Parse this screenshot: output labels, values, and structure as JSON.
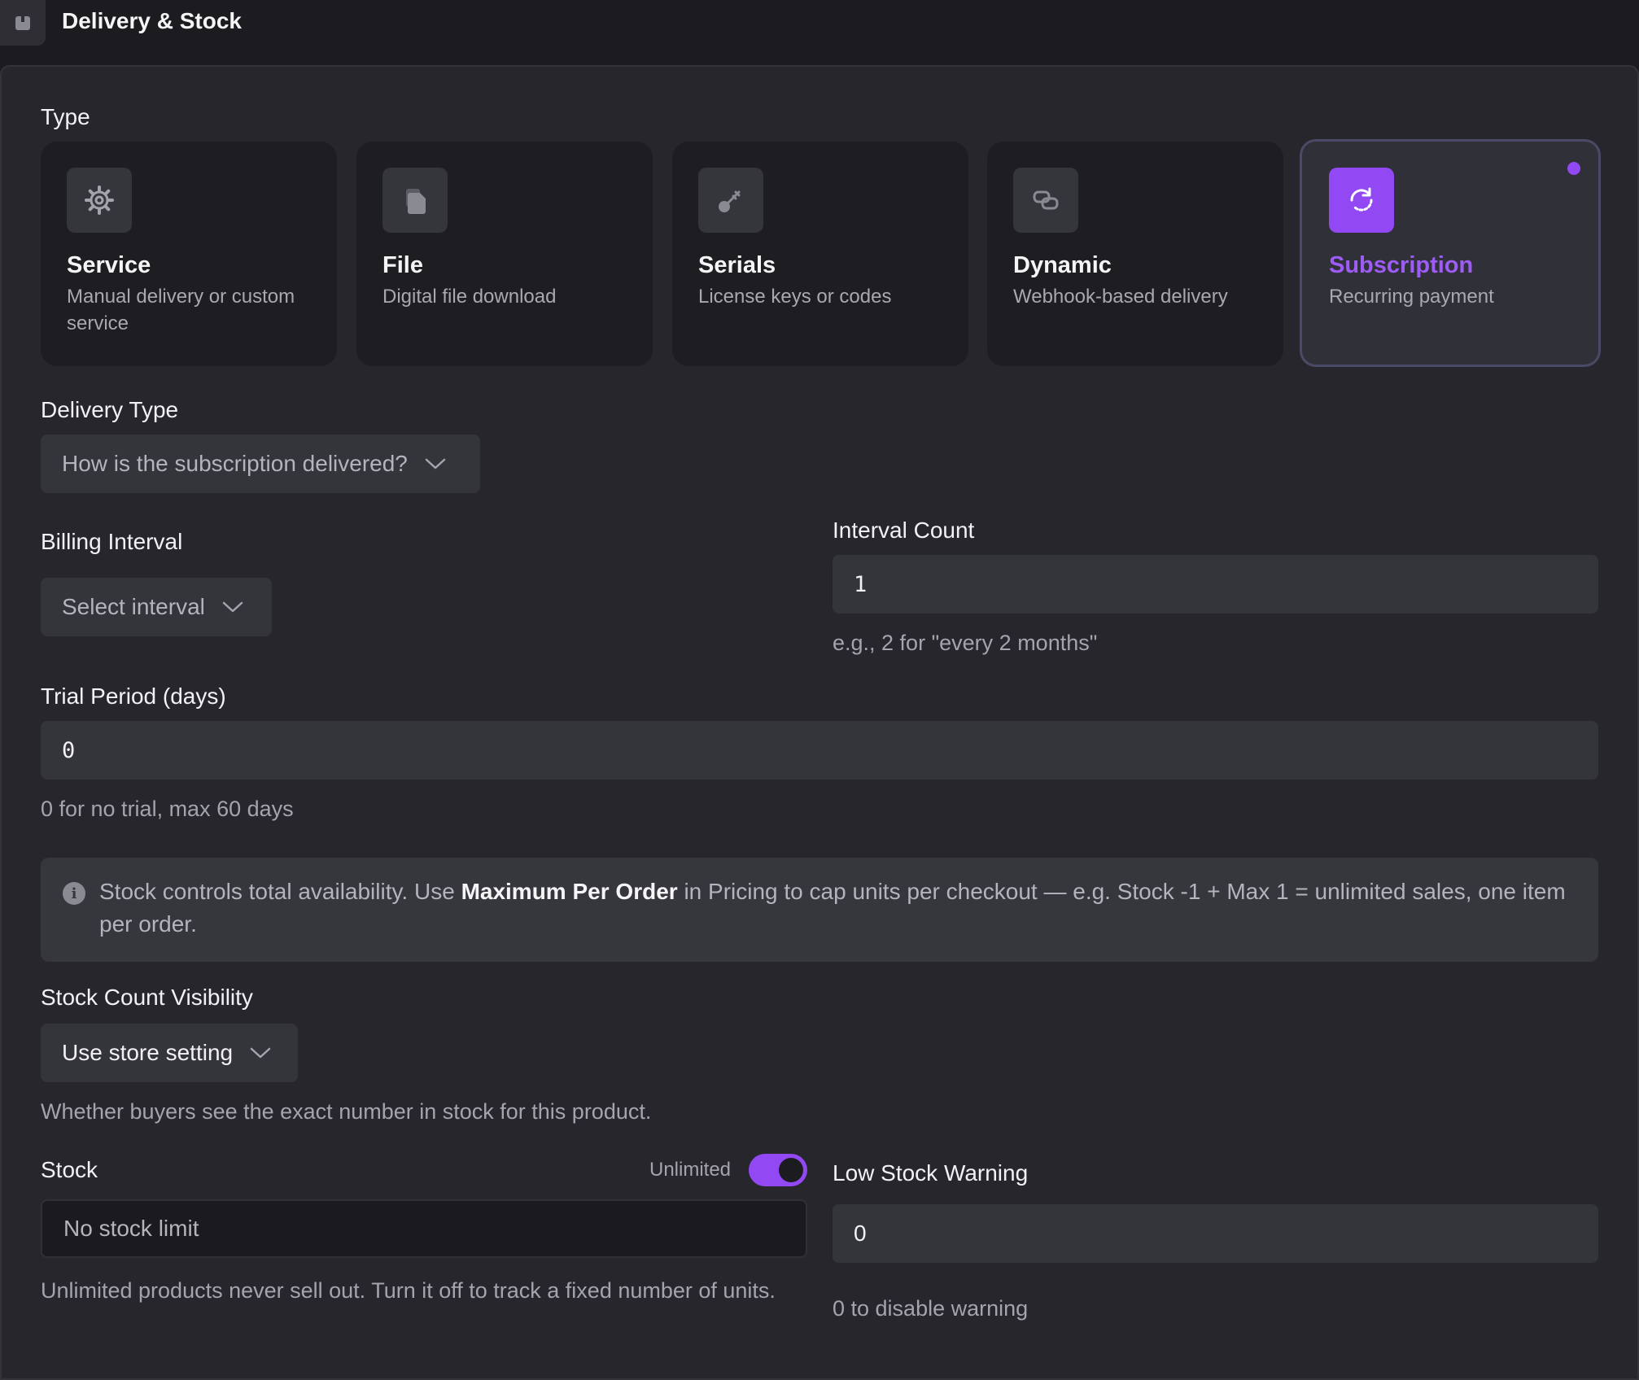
{
  "header": {
    "title": "Delivery & Stock",
    "icon": "box-icon"
  },
  "type_section": {
    "label": "Type",
    "cards": [
      {
        "name": "Service",
        "desc": "Manual delivery or custom service",
        "icon": "gear-icon"
      },
      {
        "name": "File",
        "desc": "Digital file download",
        "icon": "file-icon"
      },
      {
        "name": "Serials",
        "desc": "License keys or codes",
        "icon": "key-icon"
      },
      {
        "name": "Dynamic",
        "desc": "Webhook-based delivery",
        "icon": "link-icon"
      },
      {
        "name": "Subscription",
        "desc": "Recurring payment",
        "icon": "refresh-icon"
      }
    ],
    "selected": "Subscription"
  },
  "delivery_type": {
    "label": "Delivery Type",
    "placeholder": "How is the subscription delivered?"
  },
  "billing_interval": {
    "label": "Billing Interval",
    "placeholder": "Select interval"
  },
  "interval_count": {
    "label": "Interval Count",
    "value": "1",
    "hint": "e.g., 2 for \"every 2 months\""
  },
  "trial_period": {
    "label": "Trial Period (days)",
    "value": "0",
    "hint": "0 for no trial, max 60 days"
  },
  "info": {
    "text_before": "Stock controls total availability. Use ",
    "text_bold": "Maximum Per Order",
    "text_after": " in Pricing to cap units per checkout — e.g. Stock -1 + Max 1 = unlimited sales, one item per order."
  },
  "stock_visibility": {
    "label": "Stock Count Visibility",
    "value": "Use store setting",
    "hint": "Whether buyers see the exact number in stock for this product."
  },
  "stock": {
    "label": "Stock",
    "toggle_label": "Unlimited",
    "toggle_on": true,
    "placeholder": "No stock limit",
    "hint": "Unlimited products never sell out. Turn it off to track a fixed number of units."
  },
  "low_stock": {
    "label": "Low Stock Warning",
    "value": "0",
    "hint": "0 to disable warning"
  },
  "colors": {
    "accent": "#9248f2",
    "panel": "#26262c",
    "field": "#34343b"
  }
}
